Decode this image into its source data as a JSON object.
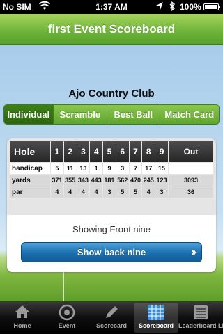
{
  "status_bar": {
    "carrier": "No SIM",
    "time": "1:37 AM",
    "battery": "100%"
  },
  "title": "first Event Scoreboard",
  "club_name": "Ajo Country Club",
  "segments": [
    {
      "label": "Individual",
      "active": true
    },
    {
      "label": "Scramble",
      "active": false
    },
    {
      "label": "Best Ball",
      "active": false
    },
    {
      "label": "Match Card",
      "active": false
    }
  ],
  "scorecard": {
    "hole_header": "Hole",
    "holes": [
      "1",
      "2",
      "3",
      "4",
      "5",
      "6",
      "7",
      "8",
      "9"
    ],
    "out_header": "Out",
    "rows": [
      {
        "label": "handicap",
        "values": [
          "5",
          "11",
          "13",
          "1",
          "9",
          "3",
          "7",
          "17",
          "15"
        ],
        "out": ""
      },
      {
        "label": "yards",
        "values": [
          "371",
          "355",
          "343",
          "443",
          "181",
          "562",
          "470",
          "245",
          "123"
        ],
        "out": "3093"
      },
      {
        "label": "par",
        "values": [
          "4",
          "4",
          "4",
          "4",
          "3",
          "5",
          "5",
          "4",
          "3"
        ],
        "out": "36"
      }
    ]
  },
  "showing_text": "Showing Front nine",
  "back_nine_button": "Show back nine",
  "tabs": [
    {
      "label": "Home",
      "icon": "home-icon",
      "active": false
    },
    {
      "label": "Event",
      "icon": "target-icon",
      "active": false
    },
    {
      "label": "Scorecard",
      "icon": "pencil-icon",
      "active": false
    },
    {
      "label": "Scoreboard",
      "icon": "grid-icon",
      "active": true
    },
    {
      "label": "Leaderboard Live",
      "icon": "list-icon",
      "active": false
    }
  ],
  "colors": {
    "title_green": "#6db33a",
    "segment_active": "#2d6610",
    "button_blue": "#1a6fb0",
    "table_header": "#262626"
  }
}
